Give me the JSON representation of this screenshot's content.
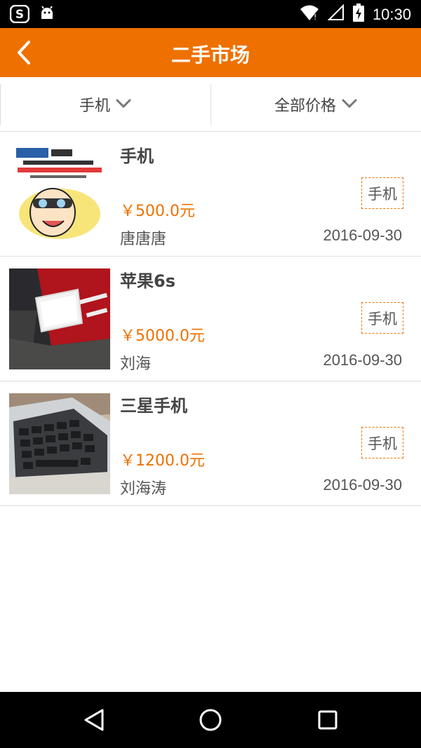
{
  "status_bar": {
    "time": "10:30",
    "icons": [
      "sogou-icon",
      "android-icon",
      "wifi-icon",
      "signal-icon",
      "battery-icon"
    ]
  },
  "app_bar": {
    "title": "二手市场",
    "back_icon": "back-arrow-icon"
  },
  "filters": [
    {
      "label": "手机",
      "icon": "chevron-down-icon"
    },
    {
      "label": "全部价格",
      "icon": "chevron-down-icon"
    }
  ],
  "items": [
    {
      "title": "手机",
      "price": "￥500.0元",
      "seller": "唐唐唐",
      "date": "2016-09-30",
      "tag": "手机",
      "image": "cartoon-meme-image"
    },
    {
      "title": "苹果6s",
      "price": "￥5000.0元",
      "seller": "刘海",
      "date": "2016-09-30",
      "tag": "手机",
      "image": "phone-photo-image"
    },
    {
      "title": "三星手机",
      "price": "￥1200.0元",
      "seller": "刘海涛",
      "date": "2016-09-30",
      "tag": "手机",
      "image": "laptop-keyboard-image"
    }
  ],
  "nav_bar": {
    "icons": [
      "back-triangle-icon",
      "home-circle-icon",
      "recents-square-icon"
    ]
  },
  "colors": {
    "accent": "#ee7100",
    "status_bar": "#000000",
    "divider": "#dcdcdc"
  }
}
